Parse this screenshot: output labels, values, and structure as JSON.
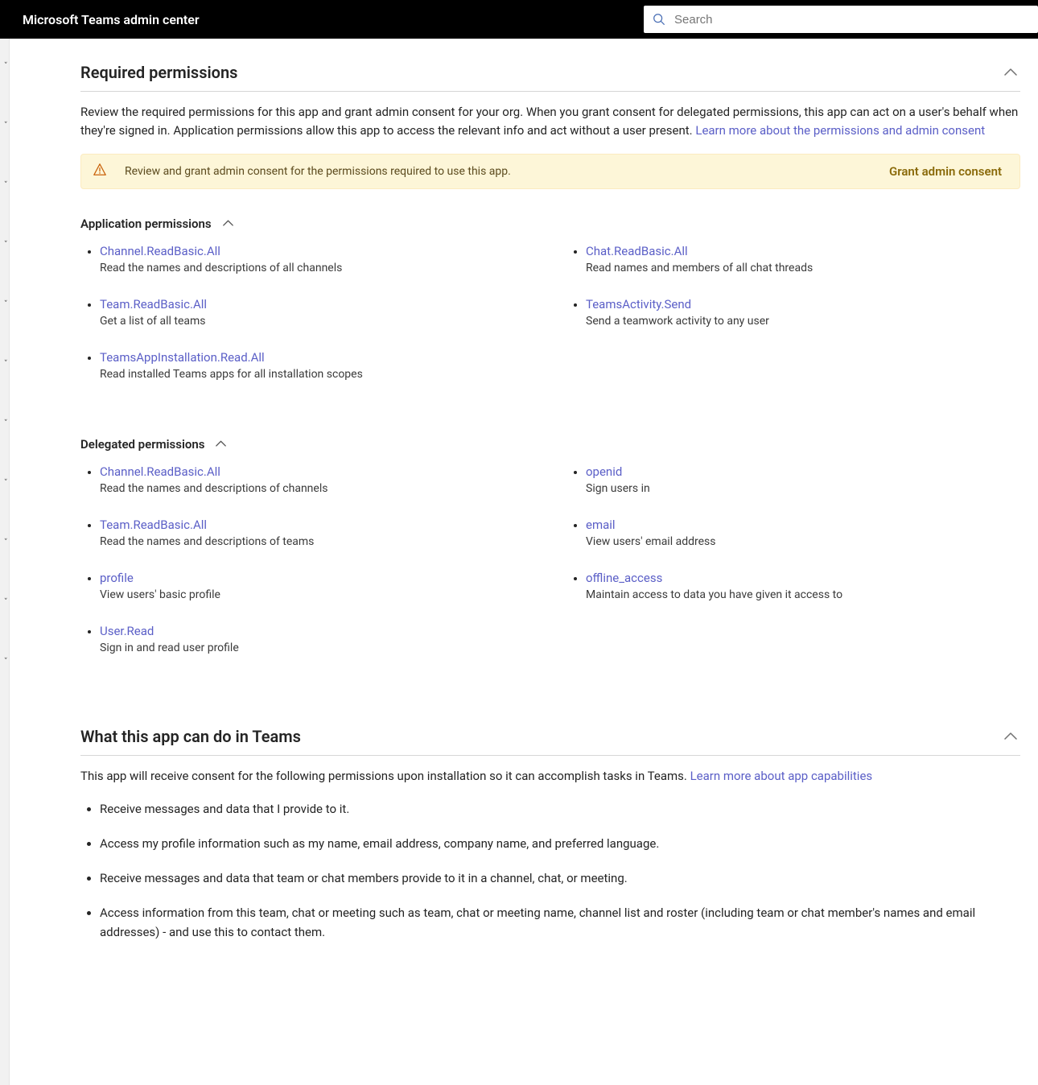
{
  "header": {
    "title": "Microsoft Teams admin center",
    "search_placeholder": "Search"
  },
  "section_permissions": {
    "title": "Required permissions",
    "desc_prefix": "Review the required permissions for this app and grant admin consent for your org. When you grant consent for delegated permissions, this app can act on a user's behalf when they're signed in. Application permissions allow this app to access the relevant info and act without a user present. ",
    "learn_more": "Learn more about the permissions and admin consent",
    "consent_banner": {
      "message": "Review and grant admin consent for the permissions required to use this app.",
      "action": "Grant admin consent"
    },
    "application": {
      "title": "Application permissions",
      "left": [
        {
          "name": "Channel.ReadBasic.All",
          "desc": "Read the names and descriptions of all channels"
        },
        {
          "name": "Team.ReadBasic.All",
          "desc": "Get a list of all teams"
        },
        {
          "name": "TeamsAppInstallation.Read.All",
          "desc": "Read installed Teams apps for all installation scopes"
        }
      ],
      "right": [
        {
          "name": "Chat.ReadBasic.All",
          "desc": "Read names and members of all chat threads"
        },
        {
          "name": "TeamsActivity.Send",
          "desc": "Send a teamwork activity to any user"
        }
      ]
    },
    "delegated": {
      "title": "Delegated permissions",
      "left": [
        {
          "name": "Channel.ReadBasic.All",
          "desc": "Read the names and descriptions of channels"
        },
        {
          "name": "Team.ReadBasic.All",
          "desc": "Read the names and descriptions of teams"
        },
        {
          "name": "profile",
          "desc": "View users' basic profile"
        },
        {
          "name": "User.Read",
          "desc": "Sign in and read user profile"
        }
      ],
      "right": [
        {
          "name": "openid",
          "desc": "Sign users in"
        },
        {
          "name": "email",
          "desc": "View users' email address"
        },
        {
          "name": "offline_access",
          "desc": "Maintain access to data you have given it access to"
        }
      ]
    }
  },
  "section_capabilities": {
    "title": "What this app can do in Teams",
    "desc_prefix": "This app will receive consent for the following permissions upon installation so it can accomplish tasks in Teams. ",
    "learn_more": "Learn more about app capabilities",
    "items": [
      "Receive messages and data that I provide to it.",
      "Access my profile information such as my name, email address, company name, and preferred language.",
      "Receive messages and data that team or chat members provide to it in a channel, chat, or meeting.",
      "Access information from this team, chat or meeting such as team, chat or meeting name, channel list and roster (including team or chat member's names and email addresses) - and use this to contact them."
    ]
  }
}
